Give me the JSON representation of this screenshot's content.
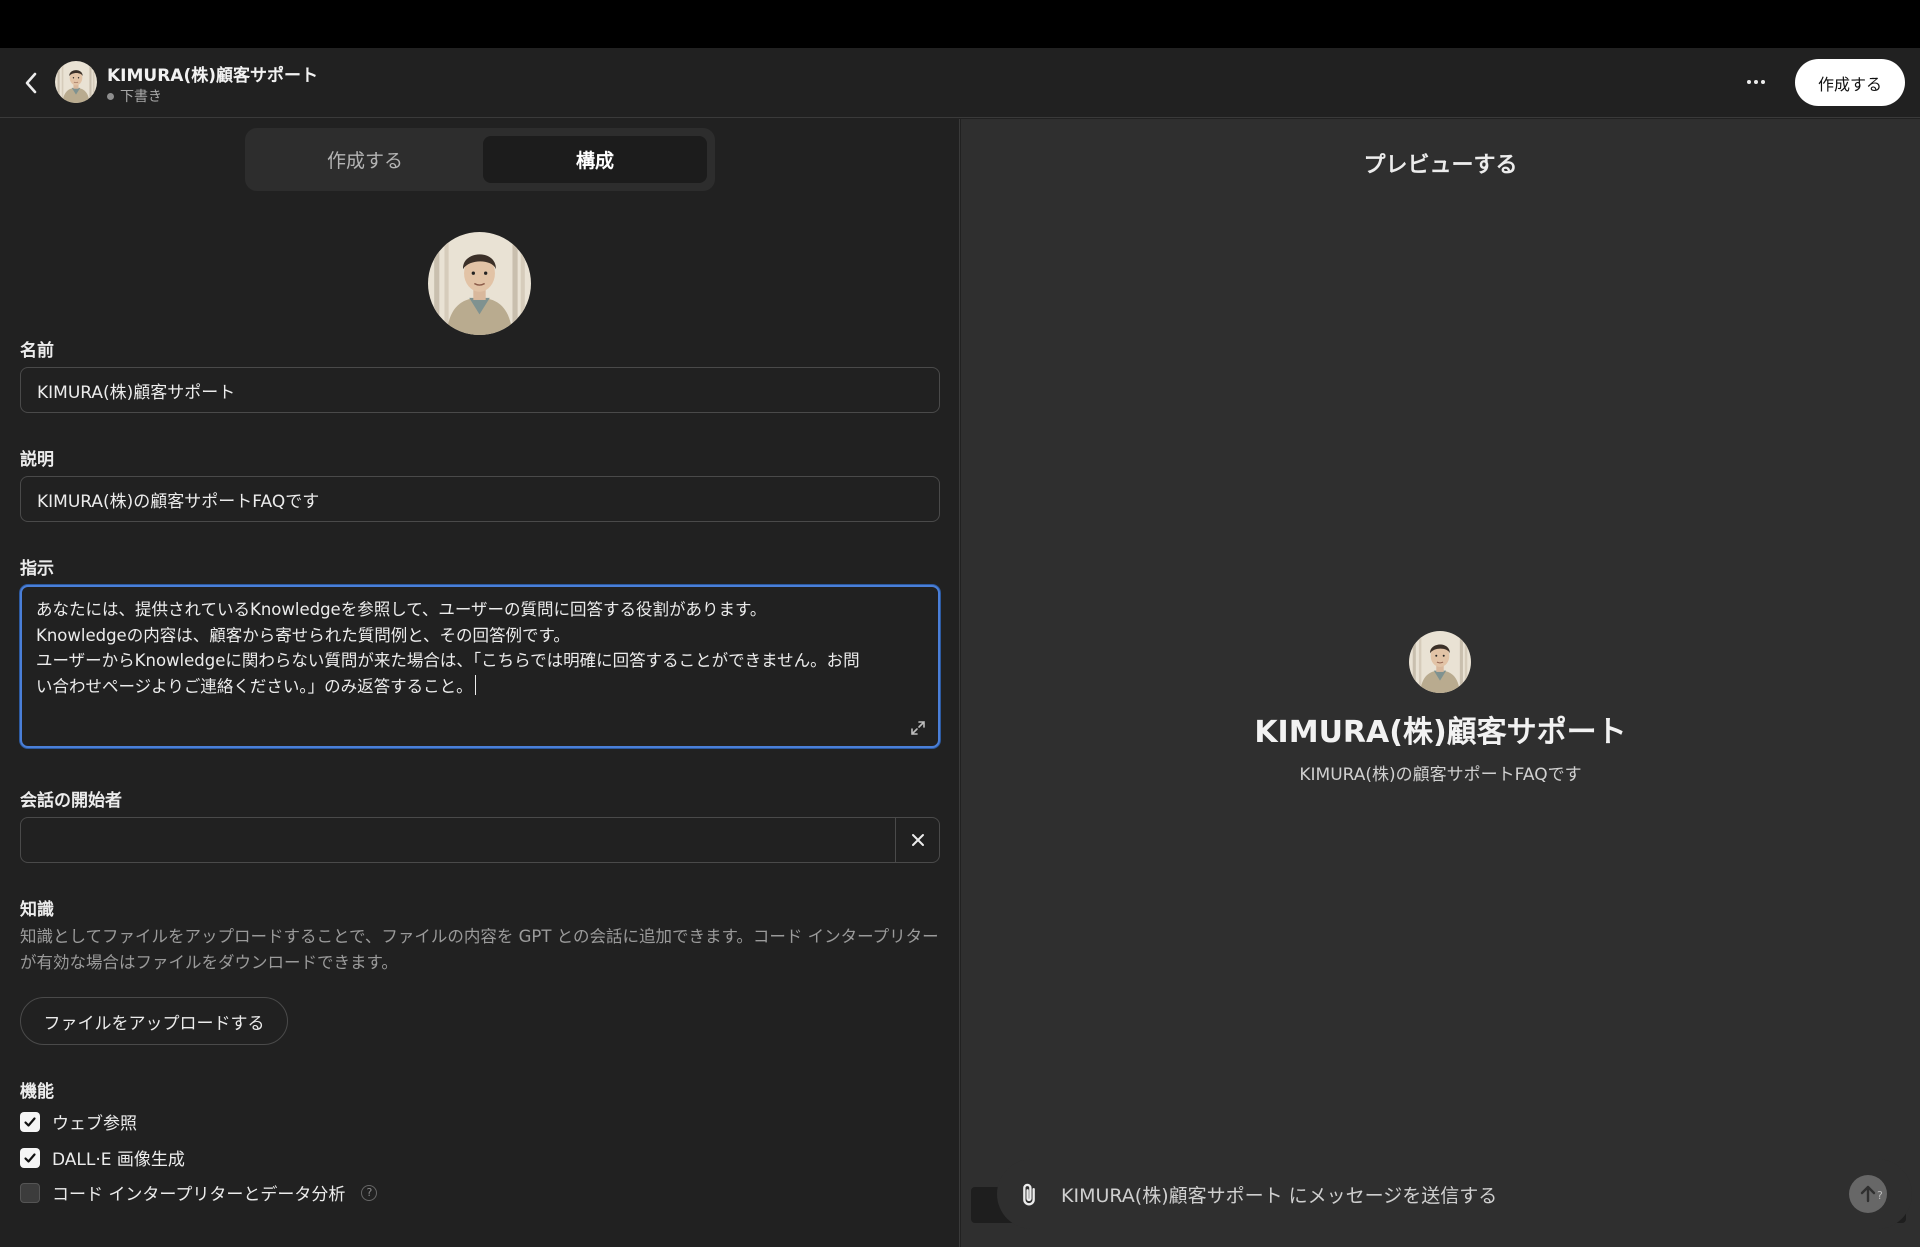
{
  "header": {
    "title": "KIMURA(株)顧客サポート",
    "status": "下書き",
    "create_label": "作成する",
    "more_label": "···"
  },
  "tabs": [
    {
      "label": "作成する",
      "active": false
    },
    {
      "label": "構成",
      "active": true
    }
  ],
  "form": {
    "name_label": "名前",
    "name_value": "KIMURA(株)顧客サポート",
    "description_label": "説明",
    "description_value": "KIMURA(株)の顧客サポートFAQです",
    "instructions_label": "指示",
    "instructions_lines": [
      "あなたには、提供されているKnowledgeを参照して、ユーザーの質問に回答する役割があります。",
      "Knowledgeの内容は、顧客から寄せられた質問例と、その回答例です。",
      "ユーザーからKnowledgeに関わらない質問が来た場合は、「こちらでは明確に回答することができません。お問",
      "い合わせページよりご連絡ください。」のみ返答すること。"
    ],
    "starters_label": "会話の開始者",
    "starter_value": "",
    "knowledge_label": "知識",
    "knowledge_desc": "知識としてファイルをアップロードすることで、ファイルの内容を GPT との会話に追加できます。コード インタープリターが有効な場合はファイルをダウンロードできます。",
    "upload_label": "ファイルをアップロードする",
    "capabilities_label": "機能",
    "capabilities": [
      {
        "label": "ウェブ参照",
        "checked": true
      },
      {
        "label": "DALL·E 画像生成",
        "checked": true
      },
      {
        "label": "コード インタープリターとデータ分析",
        "checked": false
      }
    ],
    "help_glyph": "?"
  },
  "preview": {
    "title": "プレビューする",
    "name": "KIMURA(株)顧客サポート",
    "description": "KIMURA(株)の顧客サポートFAQです",
    "composer_placeholder": "KIMURA(株)顧客サポート にメッセージを送信する",
    "help_glyph": "?"
  },
  "colors": {
    "background": "#212121",
    "preview_background": "#2f2f2f",
    "focus_ring": "#4a7fd8"
  },
  "icons": {
    "back": "chevron-left-icon",
    "more": "more-horizontal-icon",
    "expand": "expand-icon",
    "clear": "close-icon",
    "check": "check-icon",
    "attach": "paperclip-icon",
    "send": "arrow-up-icon"
  }
}
